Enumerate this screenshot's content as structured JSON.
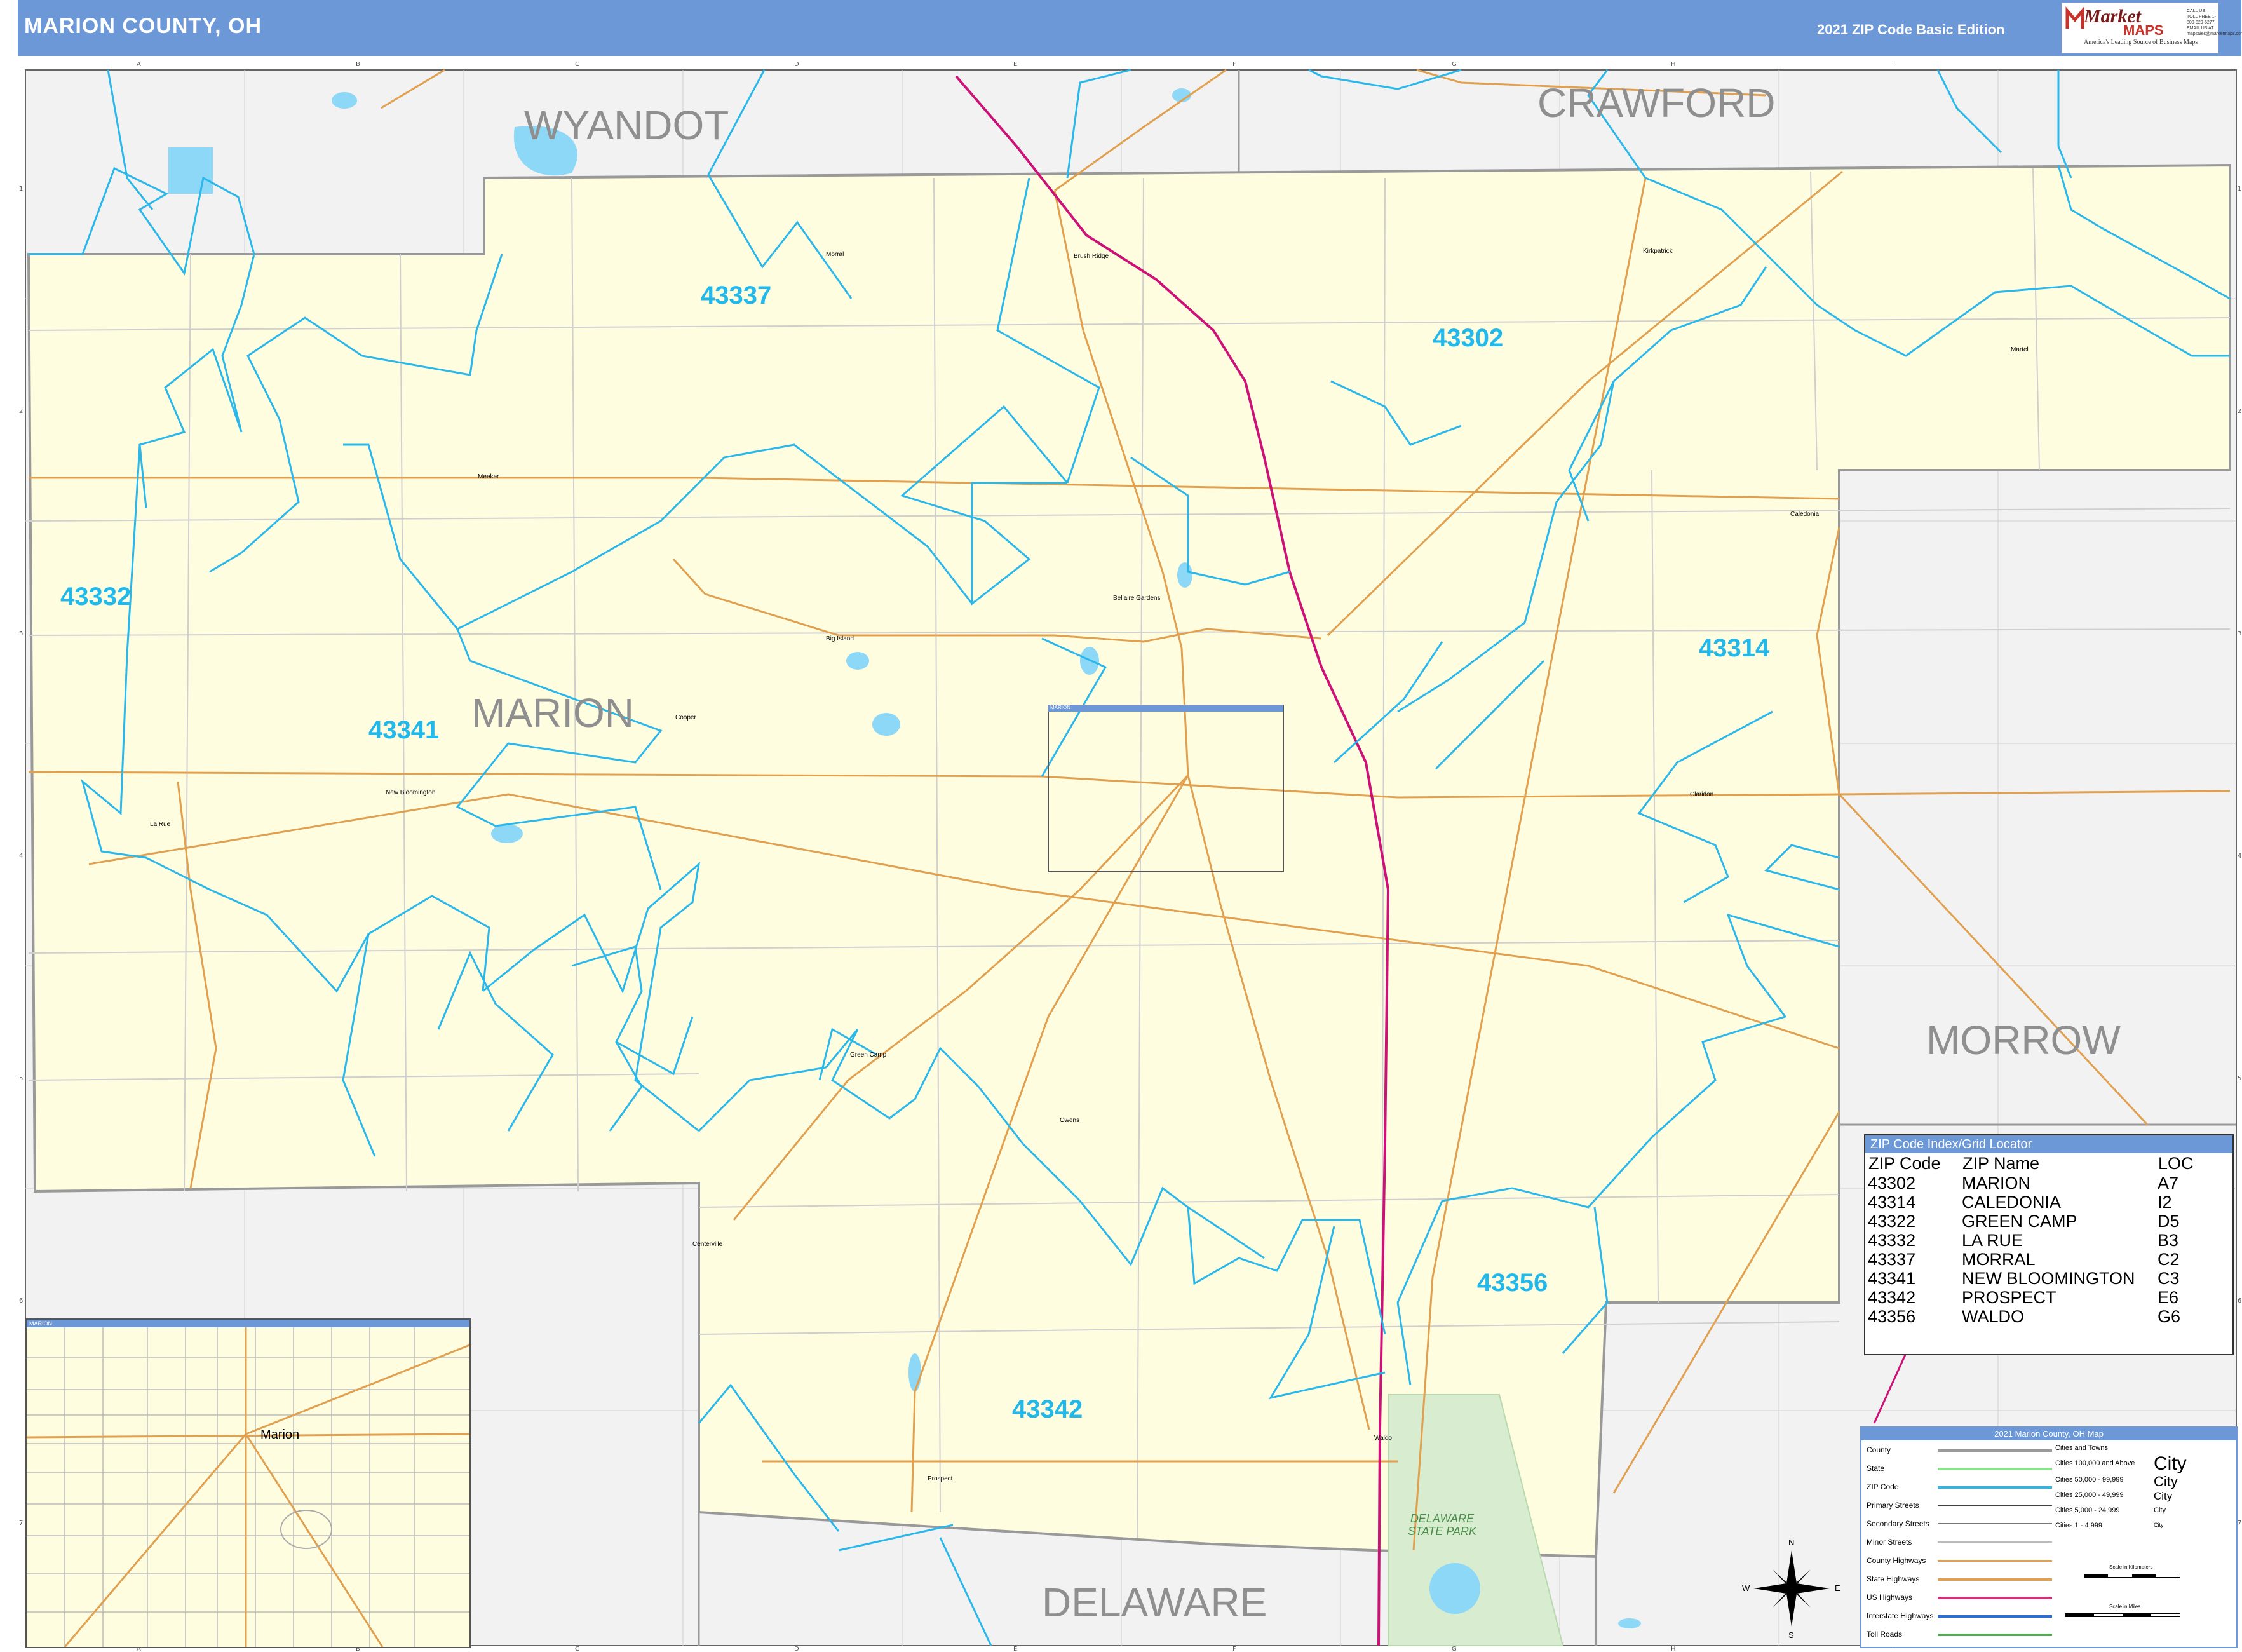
{
  "header": {
    "title": "MARION COUNTY, OH",
    "edition": "2021 ZIP Code Basic Edition"
  },
  "logo": {
    "brand_top": "Market",
    "brand_bottom": "MAPS",
    "tagline": "America's Leading Source of Business Maps",
    "contact": "CALL US TOLL FREE 1-800-829-6277 EMAIL US AT: mapsales@marketmaps.com"
  },
  "grid": {
    "columns": [
      "A",
      "B",
      "C",
      "D",
      "E",
      "F",
      "G",
      "H",
      "I"
    ],
    "rows": [
      "1",
      "2",
      "3",
      "4",
      "5",
      "6",
      "7"
    ]
  },
  "counties": {
    "wyandot": "WYANDOT",
    "crawford": "CRAWFORD",
    "marion": "MARION",
    "morrow": "MORROW",
    "delaware": "DELAWARE"
  },
  "zip_labels": {
    "z43337": "43337",
    "z43302": "43302",
    "z43332": "43332",
    "z43341": "43341",
    "z43314": "43314",
    "z43356": "43356",
    "z43342": "43342"
  },
  "towns": {
    "morral": "Morral",
    "brush_ridge": "Brush Ridge",
    "kirkpatrick": "Kirkpatrick",
    "martel": "Martel",
    "meeker": "Meeker",
    "caledonia": "Caledonia",
    "bellaire_gardens": "Bellaire Gardens",
    "big_island": "Big Island",
    "cooper": "Cooper",
    "new_bloomington": "New Bloomington",
    "la_rue": "La Rue",
    "claridon": "Claridon",
    "green_camp": "Green Camp",
    "owens": "Owens",
    "centerville": "Centerville",
    "prospect": "Prospect",
    "waldo": "Waldo",
    "marion_inset_hdr": "MARION",
    "marion_inset": "Marion"
  },
  "park": {
    "name": "DELAWARE STATE PARK"
  },
  "zip_index": {
    "title": "ZIP Code Index/Grid Locator",
    "headers": [
      "ZIP Code",
      "ZIP Name",
      "LOC"
    ],
    "rows": [
      [
        "43302",
        "MARION",
        "A7"
      ],
      [
        "43314",
        "CALEDONIA",
        "I2"
      ],
      [
        "43322",
        "GREEN CAMP",
        "D5"
      ],
      [
        "43332",
        "LA RUE",
        "B3"
      ],
      [
        "43337",
        "MORRAL",
        "C2"
      ],
      [
        "43341",
        "NEW BLOOMINGTON",
        "C3"
      ],
      [
        "43342",
        "PROSPECT",
        "E6"
      ],
      [
        "43356",
        "WALDO",
        "G6"
      ]
    ]
  },
  "legend": {
    "title": "2021 Marion County, OH Map",
    "items": [
      "County",
      "State",
      "ZIP Code",
      "Primary Streets",
      "Secondary Streets",
      "Minor Streets",
      "County Highways",
      "State Highways",
      "US Highways",
      "Interstate Highways",
      "Toll Roads"
    ],
    "colors": [
      "#999999",
      "#8fe08f",
      "#2ab8ea",
      "#444444",
      "#666666",
      "#bbbbbb",
      "#e0a050",
      "#e0a050",
      "#cc3377",
      "#2a6fd6",
      "#55aa55"
    ],
    "cities_title": "Cities and Towns",
    "city_classes": [
      "Cities 100,000 and Above",
      "Cities 50,000 - 99,999",
      "Cities 25,000 - 49,999",
      "Cities 5,000 - 24,999",
      "Cities 1 - 4,999"
    ],
    "city_samples": [
      "City",
      "City",
      "City",
      "City",
      "City"
    ],
    "scale_km": "Scale in Kilometers",
    "scale_mi": "Scale in Miles"
  },
  "compass": {
    "n": "N",
    "s": "S",
    "e": "E",
    "w": "W"
  },
  "colors": {
    "county_fill": "#fffde0",
    "outside_fill": "#f2f2f2",
    "zip_boundary": "#2ab8ea",
    "county_boundary": "#999999",
    "us_highway": "#cc1177",
    "state_highway": "#e0a050",
    "water": "#8dd7f7",
    "park": "#d8ecd0"
  }
}
